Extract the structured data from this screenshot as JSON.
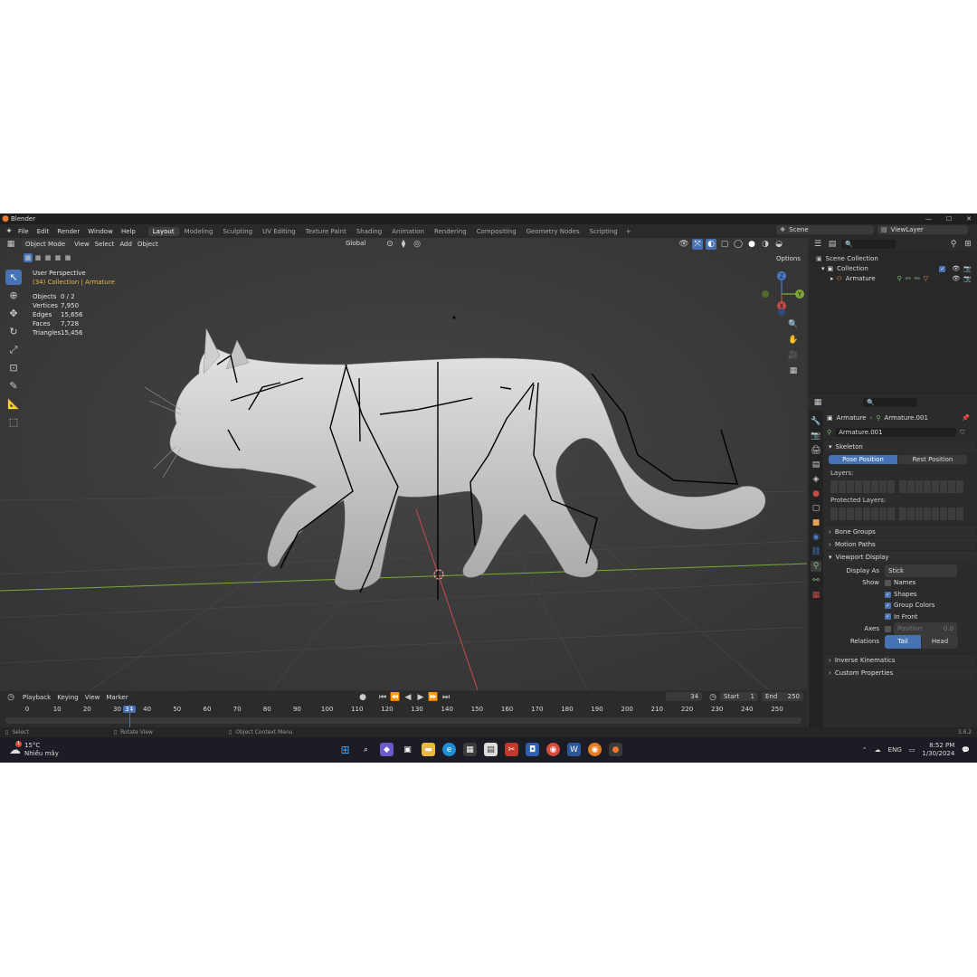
{
  "window": {
    "title": "Blender",
    "min": "—",
    "max": "☐",
    "close": "✕"
  },
  "menu": {
    "items": [
      "File",
      "Edit",
      "Render",
      "Window",
      "Help"
    ]
  },
  "workspaces": [
    "Layout",
    "Modeling",
    "Sculpting",
    "UV Editing",
    "Texture Paint",
    "Shading",
    "Animation",
    "Rendering",
    "Compositing",
    "Geometry Nodes",
    "Scripting"
  ],
  "workspace_add": "+",
  "scene": {
    "name": "Scene",
    "view_layer": "ViewLayer"
  },
  "viewport_header": {
    "mode": "Object Mode",
    "view": "View",
    "select": "Select",
    "add": "Add",
    "object": "Object",
    "orientation": "Global",
    "options": "Options"
  },
  "viewport": {
    "perspective": "User Perspective",
    "collection_info": "(34) Collection | Armature",
    "stats": [
      {
        "label": "Objects",
        "value": "0 / 2"
      },
      {
        "label": "Vertices",
        "value": "7,950"
      },
      {
        "label": "Edges",
        "value": "15,656"
      },
      {
        "label": "Faces",
        "value": "7,728"
      },
      {
        "label": "Triangles",
        "value": "15,456"
      }
    ],
    "gizmo": {
      "x": "X",
      "y": "Y",
      "z": "Z"
    }
  },
  "outliner": {
    "scene_collection": "Scene Collection",
    "collection": "Collection",
    "armature": "Armature"
  },
  "properties": {
    "breadcrumb_object": "Armature",
    "breadcrumb_data": "Armature.001",
    "data_name": "Armature.001",
    "skeleton": "Skeleton",
    "pose_position": "Pose Position",
    "rest_position": "Rest Position",
    "layers": "Layers:",
    "protected_layers": "Protected Layers:",
    "bone_groups": "Bone Groups",
    "motion_paths": "Motion Paths",
    "viewport_display": "Viewport Display",
    "display_as_label": "Display As",
    "display_as_value": "Stick",
    "show_label": "Show",
    "names": "Names",
    "shapes": "Shapes",
    "group_colors": "Group Colors",
    "in_front": "In Front",
    "axes_label": "Axes",
    "position_label": "Position",
    "position_value": "0.0",
    "relations_label": "Relations",
    "tail": "Tail",
    "head": "Head",
    "inverse_kinematics": "Inverse Kinematics",
    "custom_properties": "Custom Properties"
  },
  "timeline": {
    "playback": "Playback",
    "keying": "Keying",
    "view": "View",
    "marker": "Marker",
    "current_frame": "34",
    "start_label": "Start",
    "start_value": "1",
    "end_label": "End",
    "end_value": "250",
    "ticks": [
      "0",
      "10",
      "20",
      "30",
      "34",
      "40",
      "50",
      "60",
      "70",
      "80",
      "90",
      "100",
      "110",
      "120",
      "130",
      "140",
      "150",
      "160",
      "170",
      "180",
      "190",
      "200",
      "210",
      "220",
      "230",
      "240",
      "250"
    ]
  },
  "statusbar": {
    "select": "Select",
    "rotate": "Rotate View",
    "context": "Object Context Menu",
    "version": "3.6.2"
  },
  "taskbar": {
    "temp": "15°C",
    "weather": "Nhiều mây",
    "lang": "ENG",
    "time": "8:52 PM",
    "date": "1/30/2024",
    "badge": "1"
  },
  "colors": {
    "accent": "#4772b3",
    "frame": "#4772b3",
    "bone": "#000000",
    "mesh": "#d6d6d6",
    "x_axis": "#c84a4a",
    "y_axis": "#7fa83a"
  }
}
